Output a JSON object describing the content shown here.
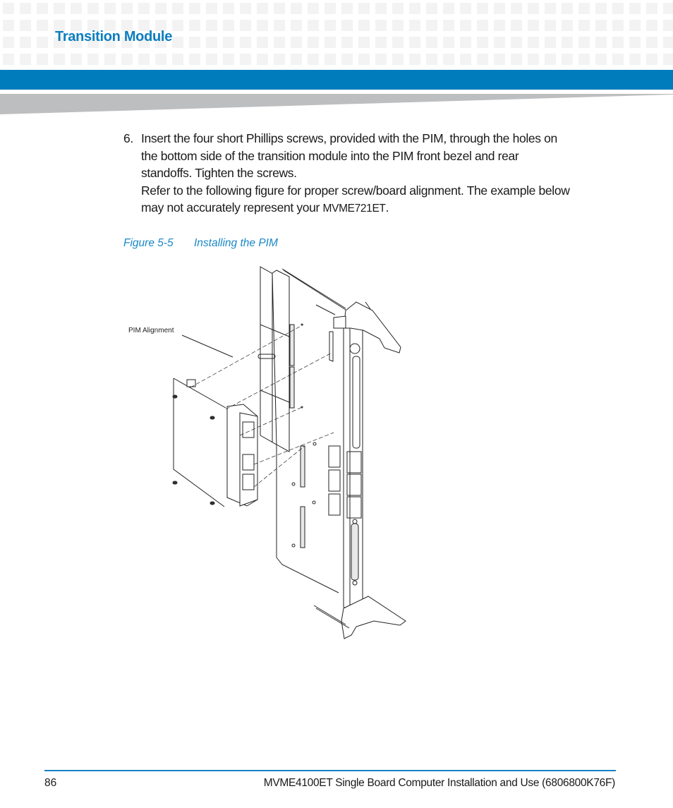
{
  "header": {
    "section_title": "Transition Module",
    "brand_colors": {
      "accent_blue": "#007cbd",
      "title_blue": "#0b7ec0",
      "wedge_grey": "#bdbec0",
      "grid_grey": "#f3f3f3"
    }
  },
  "step": {
    "number": "6.",
    "lines": [
      "Insert the four short Phillips screws, provided with the PIM, through the holes on",
      "the bottom side of the transition module into the PIM front bezel and rear",
      "standoffs. Tighten the screws.",
      "Refer to the following figure for proper screw/board alignment. The example below",
      "may not accurately represent your "
    ],
    "model": "MVME721ET",
    "end": "."
  },
  "figure": {
    "label": "Figure 5-5",
    "title": "Installing the PIM",
    "callout": "PIM  Alignment"
  },
  "footer": {
    "page_number": "86",
    "document_title": "MVME4100ET Single Board Computer Installation and Use (6806800K76F)"
  }
}
